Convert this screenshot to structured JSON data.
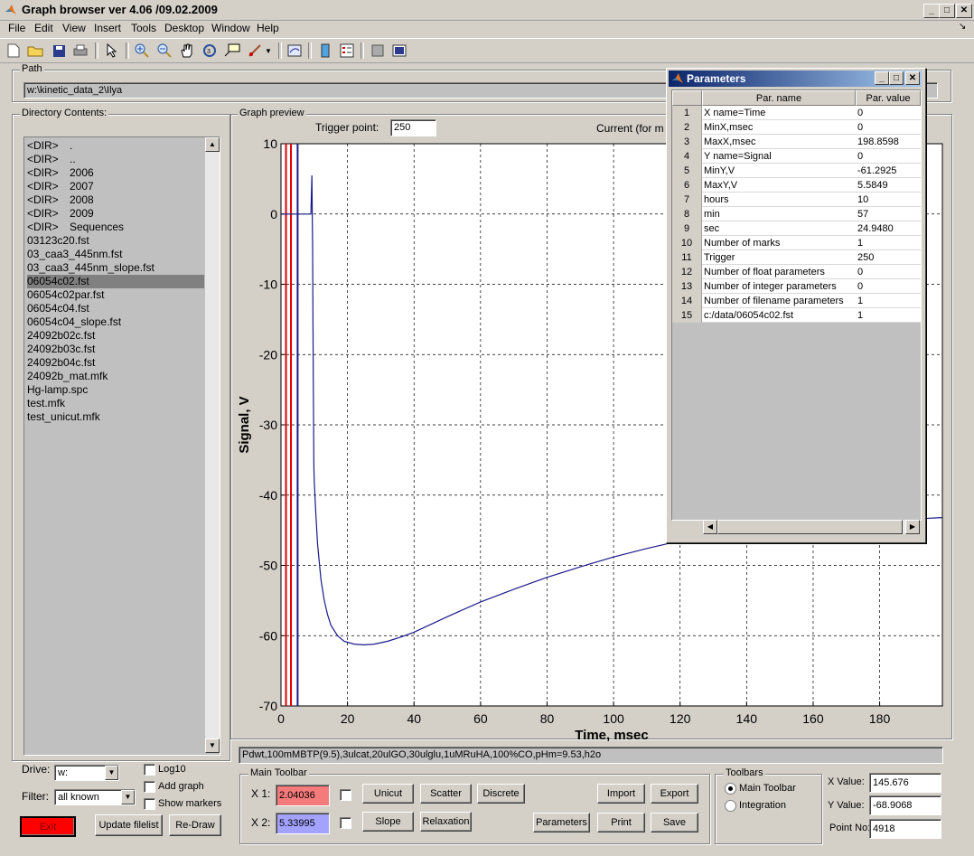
{
  "window": {
    "title": "Graph browser ver 4.06 /09.02.2009"
  },
  "menu": [
    "File",
    "Edit",
    "View",
    "Insert",
    "Tools",
    "Desktop",
    "Window",
    "Help"
  ],
  "path": {
    "label": "Path",
    "value": "w:\\kinetic_data_2\\Ilya"
  },
  "directory": {
    "label": "Directory Contents:",
    "items": [
      {
        "type": "<DIR>",
        "name": "."
      },
      {
        "type": "<DIR>",
        "name": ".."
      },
      {
        "type": "<DIR>",
        "name": "2006"
      },
      {
        "type": "<DIR>",
        "name": "2007"
      },
      {
        "type": "<DIR>",
        "name": "2008"
      },
      {
        "type": "<DIR>",
        "name": "2009"
      },
      {
        "type": "<DIR>",
        "name": "Sequences"
      },
      {
        "type": "",
        "name": "03123c20.fst"
      },
      {
        "type": "",
        "name": "03_caa3_445nm.fst"
      },
      {
        "type": "",
        "name": "03_caa3_445nm_slope.fst"
      },
      {
        "type": "",
        "name": "06054c02.fst"
      },
      {
        "type": "",
        "name": "06054c02par.fst"
      },
      {
        "type": "",
        "name": "06054c04.fst"
      },
      {
        "type": "",
        "name": "06054c04_slope.fst"
      },
      {
        "type": "",
        "name": "24092b02c.fst"
      },
      {
        "type": "",
        "name": "24092b03c.fst"
      },
      {
        "type": "",
        "name": "24092b04c.fst"
      },
      {
        "type": "",
        "name": "24092b_mat.mfk"
      },
      {
        "type": "",
        "name": "Hg-lamp.spc"
      },
      {
        "type": "",
        "name": "test.mfk"
      },
      {
        "type": "",
        "name": "test_unicut.mfk"
      }
    ],
    "selected_index": 10
  },
  "left_controls": {
    "drive_label": "Drive:",
    "drive_value": "w:",
    "filter_label": "Filter:",
    "filter_value": "all known",
    "log10": "Log10",
    "add_graph": "Add graph",
    "show_markers": "Show markers",
    "exit": "Exit",
    "update": "Update filelist",
    "redraw": "Re-Draw"
  },
  "graph_preview": {
    "label": "Graph preview",
    "trigger_label": "Trigger point:",
    "trigger_value": "250",
    "current_label": "Current (for m"
  },
  "chart_data": {
    "type": "line",
    "xlabel": "Time, msec",
    "ylabel": "Signal, V",
    "xlim": [
      0,
      198.86
    ],
    "ylim": [
      -70,
      10
    ],
    "xticks": [
      0,
      20,
      40,
      60,
      80,
      100,
      120,
      140,
      160,
      180
    ],
    "yticks": [
      10,
      0,
      -10,
      -20,
      -30,
      -40,
      -50,
      -60,
      -70
    ],
    "grid": true,
    "series": [
      {
        "color": "#1a1a8c",
        "x": [
          0,
          9.0,
          9.3,
          9.5,
          9.7,
          9.9,
          10.0,
          10.5,
          11,
          12,
          13,
          14,
          15,
          17,
          19,
          22,
          25,
          28,
          32,
          36,
          40,
          50,
          60,
          70,
          80,
          90,
          100,
          110,
          120,
          130,
          140,
          150,
          160,
          170,
          180,
          190,
          198.86
        ],
        "y": [
          0,
          0,
          5.5,
          -5,
          -23,
          -36,
          -38,
          -43,
          -47,
          -52,
          -55,
          -57,
          -58.5,
          -60,
          -60.8,
          -61.2,
          -61.3,
          -61.2,
          -60.8,
          -60.2,
          -59.5,
          -57.3,
          -55.2,
          -53.4,
          -51.7,
          -50.2,
          -48.8,
          -47.6,
          -46.5,
          -45.6,
          -44.8,
          -44.4,
          -44.0,
          -43.8,
          -43.6,
          -43.4,
          -43.2
        ]
      }
    ],
    "markers": [
      {
        "x": 1.5,
        "color": "#e00000"
      },
      {
        "x": 3.0,
        "color": "#e00000"
      },
      {
        "x": 5.0,
        "color": "#1a1a8c"
      }
    ]
  },
  "description": "Pdwt,100mMBTP(9.5),3ulcat,20ulGO,30ulglu,1uMRuHA,100%CO,pHm=9.53,h2o",
  "main_toolbar": {
    "label": "Main Toolbar",
    "x1_label": "X 1:",
    "x1_value": "2.04036",
    "x1_color": "#f57a7a",
    "x2_label": "X 2:",
    "x2_value": "5.33995",
    "x2_color": "#a3a3ff",
    "unicut": "Unicut",
    "scatter": "Scatter",
    "discrete": "Discrete",
    "slope": "Slope",
    "relaxation": "Relaxation",
    "import": "Import",
    "export": "Export",
    "parameters": "Parameters",
    "print": "Print",
    "save": "Save"
  },
  "toolbars": {
    "label": "Toolbars",
    "opt1": "Main Toolbar",
    "opt2": "Integration"
  },
  "readout": {
    "x_label": "X Value:",
    "x_value": "145.676",
    "y_label": "Y Value:",
    "y_value": "-68.9068",
    "p_label": "Point No:",
    "p_value": "4918"
  },
  "parameters_window": {
    "title": "Parameters",
    "col1": "Par. name",
    "col2": "Par. value",
    "rows": [
      {
        "n": "1",
        "k": "X name=Time",
        "v": "0"
      },
      {
        "n": "2",
        "k": "MinX,msec",
        "v": "0"
      },
      {
        "n": "3",
        "k": "MaxX,msec",
        "v": "198.8598"
      },
      {
        "n": "4",
        "k": "Y name=Signal",
        "v": "0"
      },
      {
        "n": "5",
        "k": "MinY,V",
        "v": "-61.2925"
      },
      {
        "n": "6",
        "k": "MaxY,V",
        "v": "5.5849"
      },
      {
        "n": "7",
        "k": "hours",
        "v": "10"
      },
      {
        "n": "8",
        "k": "min",
        "v": "57"
      },
      {
        "n": "9",
        "k": "sec",
        "v": "24.9480"
      },
      {
        "n": "10",
        "k": "Number of marks",
        "v": "1"
      },
      {
        "n": "11",
        "k": "Trigger",
        "v": "250"
      },
      {
        "n": "12",
        "k": "Number of float parameters",
        "v": "0"
      },
      {
        "n": "13",
        "k": "Number of integer parameters",
        "v": "0"
      },
      {
        "n": "14",
        "k": "Number of filename parameters",
        "v": "1"
      },
      {
        "n": "15",
        "k": "c:/data/06054c02.fst",
        "v": "1"
      }
    ]
  }
}
